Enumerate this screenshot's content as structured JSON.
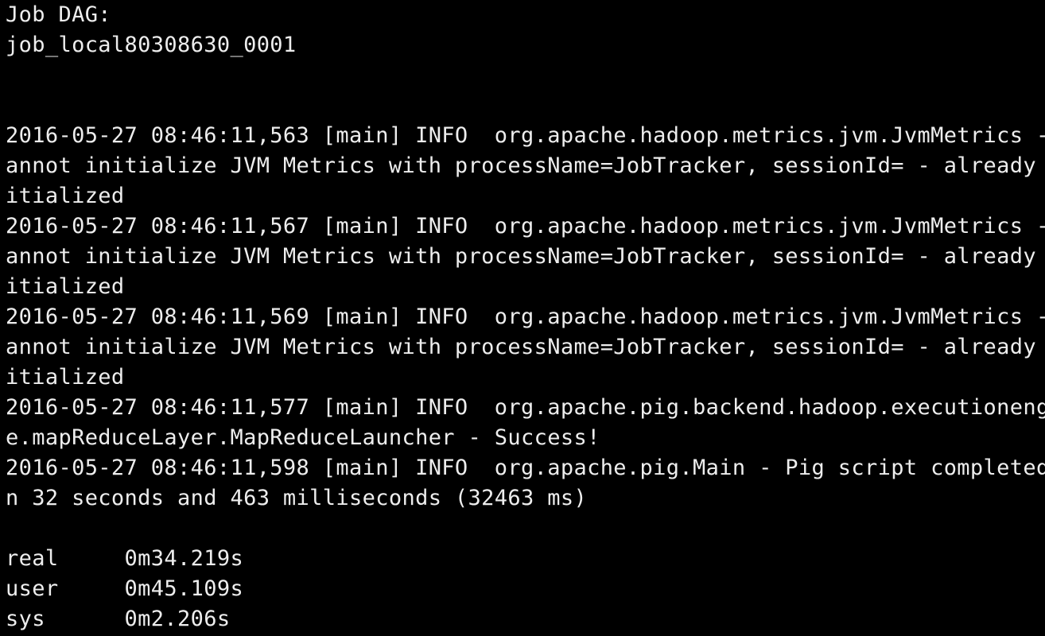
{
  "terminal": {
    "text_color": "#ededed",
    "background": "#000000",
    "lines": {
      "l00": "Job DAG:",
      "l01": "job_local80308630_0001",
      "l02": "",
      "l03": "",
      "l04": "2016-05-27 08:46:11,563 [main] INFO  org.apache.hadoop.metrics.jvm.JvmMetrics - C",
      "l05": "annot initialize JVM Metrics with processName=JobTracker, sessionId= - already in",
      "l06": "itialized",
      "l07": "2016-05-27 08:46:11,567 [main] INFO  org.apache.hadoop.metrics.jvm.JvmMetrics - C",
      "l08": "annot initialize JVM Metrics with processName=JobTracker, sessionId= - already in",
      "l09": "itialized",
      "l10": "2016-05-27 08:46:11,569 [main] INFO  org.apache.hadoop.metrics.jvm.JvmMetrics - C",
      "l11": "annot initialize JVM Metrics with processName=JobTracker, sessionId= - already in",
      "l12": "itialized",
      "l13": "2016-05-27 08:46:11,577 [main] INFO  org.apache.pig.backend.hadoop.executionengin",
      "l14": "e.mapReduceLayer.MapReduceLauncher - Success!",
      "l15": "2016-05-27 08:46:11,598 [main] INFO  org.apache.pig.Main - Pig script completed i",
      "l16": "n 32 seconds and 463 milliseconds (32463 ms)",
      "l17": "",
      "l18": "real\t0m34.219s",
      "l19": "user\t0m45.109s",
      "l20": "sys\t0m2.206s"
    }
  }
}
